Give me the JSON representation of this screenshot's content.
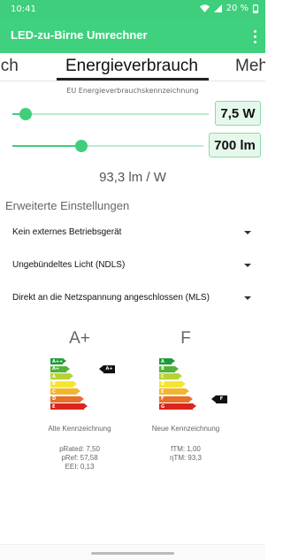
{
  "status": {
    "time": "10:41",
    "battery": "20 %"
  },
  "app": {
    "title": "LED-zu-Birne Umrechner"
  },
  "tabs": [
    {
      "label": "eich"
    },
    {
      "label": "Energieverbrauch",
      "selected": true
    },
    {
      "label": "Meh"
    }
  ],
  "eu_label_title": "EU Energieverbrauchskennzeichnung",
  "power": {
    "value": "7,5 W",
    "level": 0.04
  },
  "lumen": {
    "value": "700 lm",
    "level": 0.35
  },
  "efficiency": "93,3 lm / W",
  "advanced": {
    "title": "Erweiterte Einstellungen",
    "dropdowns": [
      {
        "label": "Kein externes Betriebsgerät"
      },
      {
        "label": "Ungebündeltes Licht (NDLS)"
      },
      {
        "label": "Direkt an die Netzspannung angeschlossen (MLS)"
      }
    ]
  },
  "old_label": {
    "rating": "A+",
    "classes": [
      "A++",
      "A+",
      "A",
      "B",
      "C",
      "D",
      "E"
    ],
    "marker": "A+",
    "caption": "Alte Kennzeichnung",
    "metrics": [
      "pRated: 7,50",
      "pRef: 57,58",
      "EEI: 0,13"
    ]
  },
  "new_label": {
    "rating": "F",
    "classes": [
      "A",
      "B",
      "C",
      "D",
      "E",
      "F",
      "G"
    ],
    "marker": "F",
    "caption": "Neue Kennzeichnung",
    "metrics": [
      "fTM: 1,00",
      "ηTM: 93,3"
    ]
  },
  "colors": {
    "accent": "#3fcf7c",
    "label_scale": [
      "#1f9a3e",
      "#53b233",
      "#b6d334",
      "#f4e533",
      "#f2b531",
      "#e8702a",
      "#d9261c"
    ]
  }
}
